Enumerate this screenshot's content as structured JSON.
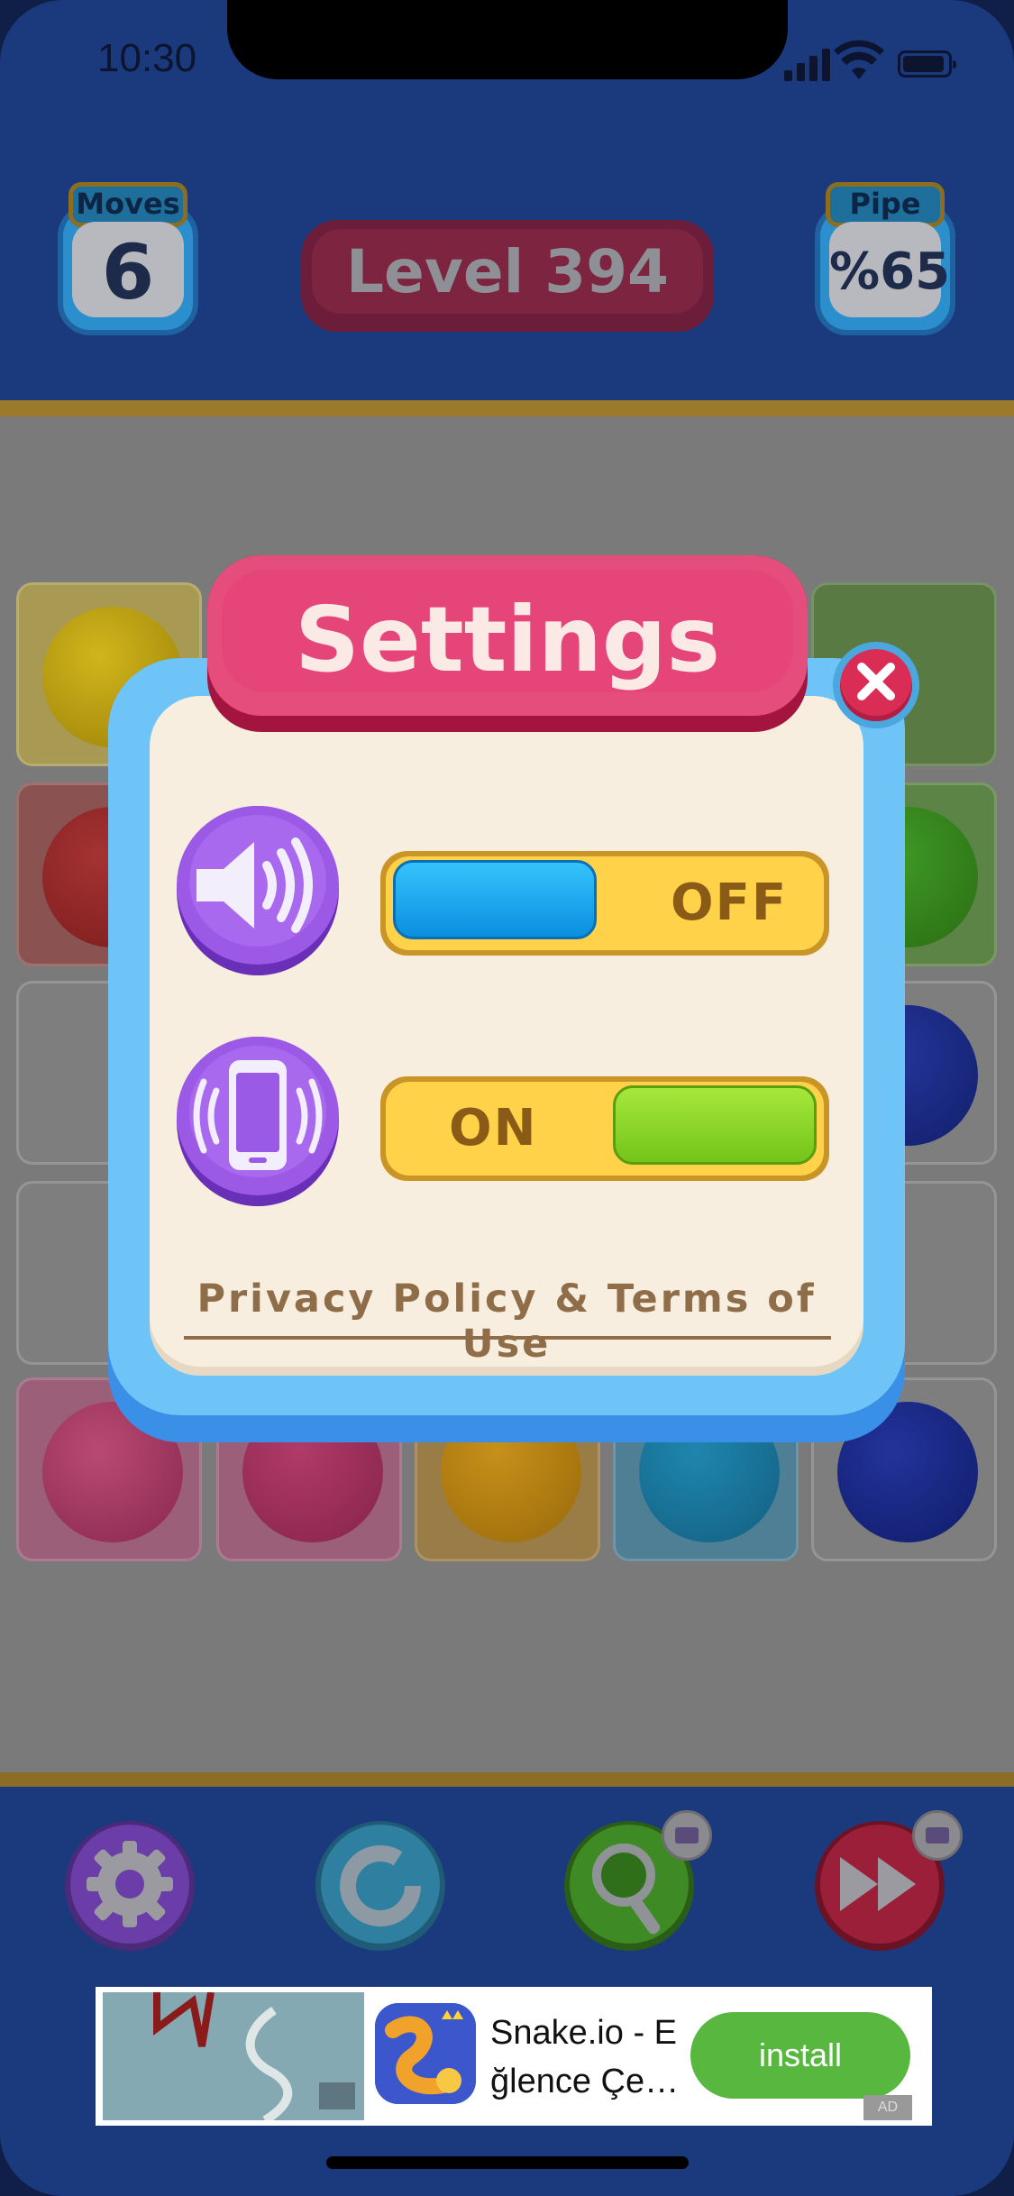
{
  "status_bar": {
    "time": "10:30"
  },
  "hud": {
    "moves": {
      "label": "Moves",
      "value": "6"
    },
    "level": {
      "label": "Level 394"
    },
    "pipe": {
      "label": "Pipe",
      "value": "%65"
    }
  },
  "board": {
    "tile_colors": [
      "#a89a52",
      "#8a5250",
      "#7e7e7e",
      "#7e7e7e",
      "#9c5f79"
    ],
    "ball_colors": [
      "#b59a12",
      "#8f2c2c",
      "",
      "",
      "#a0365e"
    ]
  },
  "settings": {
    "title": "Settings",
    "close_icon": "close-icon",
    "sound": {
      "icon": "speaker-icon",
      "state": "OFF",
      "knob_color": "#12a0e6"
    },
    "vibration": {
      "icon": "phone-vibrate-icon",
      "state": "ON",
      "knob_color": "#8fdc1f"
    },
    "privacy_link": "Privacy Policy & Terms of Use"
  },
  "toolbar": {
    "buttons": [
      {
        "icon": "gear-icon",
        "color": "#6a3da8"
      },
      {
        "icon": "undo-icon",
        "color": "#2f7fa0"
      },
      {
        "icon": "magnifier-icon",
        "color": "#3e8a24",
        "has_video": true
      },
      {
        "icon": "fast-forward-icon",
        "color": "#9c1f3a",
        "has_video": true
      }
    ]
  },
  "ad": {
    "title": "Snake.io - E\nğlence Çe…",
    "install_label": "install",
    "ad_tag": "AD"
  }
}
